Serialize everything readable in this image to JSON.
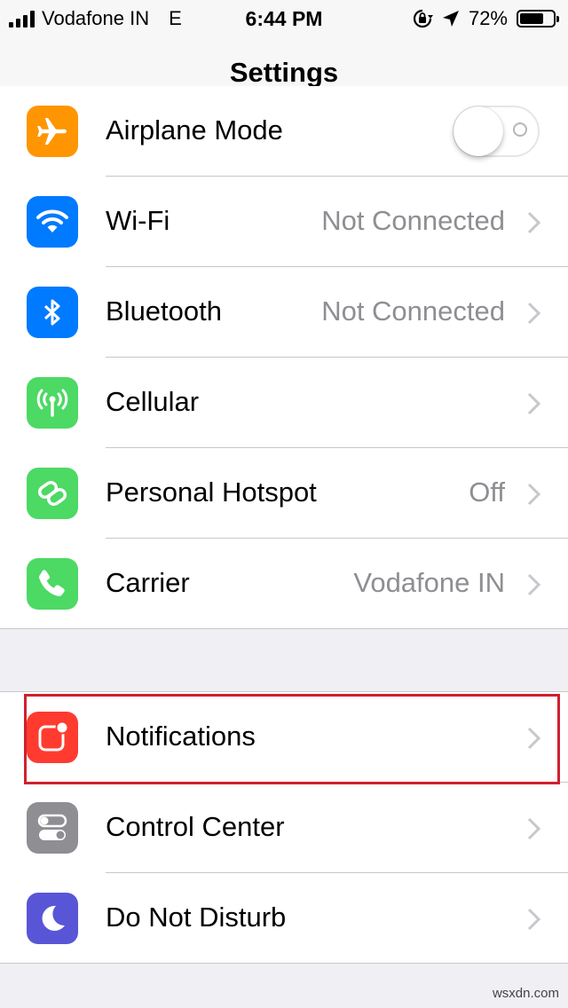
{
  "status_bar": {
    "carrier": "Vodafone IN",
    "network": "E",
    "time": "6:44 PM",
    "battery_percent": "72%",
    "battery_level": 0.72,
    "icons": [
      "signal-bars-icon",
      "orientation-lock-icon",
      "location-arrow-icon",
      "battery-icon"
    ]
  },
  "nav": {
    "title": "Settings"
  },
  "group1": {
    "rows": [
      {
        "label": "Airplane Mode",
        "icon": "airplane-icon",
        "color": "#ff9500",
        "control": "toggle",
        "toggle_on": false
      },
      {
        "label": "Wi-Fi",
        "icon": "wifi-icon",
        "color": "#007aff",
        "value": "Not Connected"
      },
      {
        "label": "Bluetooth",
        "icon": "bluetooth-icon",
        "color": "#007aff",
        "value": "Not Connected"
      },
      {
        "label": "Cellular",
        "icon": "cellular-antenna-icon",
        "color": "#4cd964"
      },
      {
        "label": "Personal Hotspot",
        "icon": "hotspot-icon",
        "color": "#4cd964",
        "value": "Off"
      },
      {
        "label": "Carrier",
        "icon": "phone-icon",
        "color": "#4cd964",
        "value": "Vodafone IN"
      }
    ]
  },
  "group2": {
    "rows": [
      {
        "label": "Notifications",
        "icon": "notifications-icon",
        "color": "#ff3b30",
        "highlighted": true
      },
      {
        "label": "Control Center",
        "icon": "control-center-icon",
        "color": "#8e8e93"
      },
      {
        "label": "Do Not Disturb",
        "icon": "moon-icon",
        "color": "#5856d6"
      }
    ]
  },
  "colors": {
    "highlight": "#d0202e",
    "secondary_text": "#8e8e93",
    "separator": "#c8c7cc"
  },
  "watermark": "wsxdn.com"
}
